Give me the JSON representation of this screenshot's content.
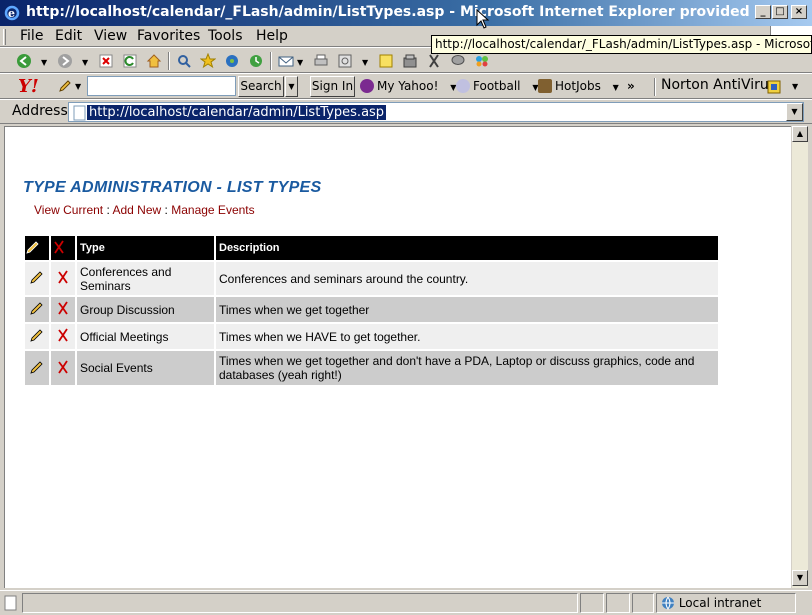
{
  "window": {
    "title": "http://localhost/calendar/_FLash/admin/ListTypes.asp - Microsoft Internet Explorer provided by AT&...",
    "buttons": {
      "minimize": "_",
      "maximize": "□",
      "close": "×"
    }
  },
  "menu": {
    "items": [
      "File",
      "Edit",
      "View",
      "Favorites",
      "Tools",
      "Help"
    ]
  },
  "tooltip": {
    "text": "http://localhost/calendar/_FLash/admin/ListTypes.asp - Microsoft Internet Explorer provided by AT&T"
  },
  "yahoo": {
    "logo": "Y!",
    "search_label": "Search",
    "signin_label": "Sign In",
    "links": [
      "My Yahoo!",
      "Football",
      "HotJobs"
    ],
    "more": "»",
    "antivirus": "Norton AntiVirus"
  },
  "address": {
    "label": "Address",
    "url": "http://localhost/calendar/admin/ListTypes.asp"
  },
  "page": {
    "title": "TYPE ADMINISTRATION - LIST TYPES",
    "nav": {
      "view_current": "View Current",
      "add_new": "Add New",
      "manage_events": "Manage Events",
      "sep": ":"
    },
    "table": {
      "headers": {
        "type": "Type",
        "description": "Description"
      },
      "rows": [
        {
          "type": "Conferences and Seminars",
          "description": "Conferences and seminars around the country."
        },
        {
          "type": "Group Discussion",
          "description": "Times when we get together"
        },
        {
          "type": "Official Meetings",
          "description": "Times when we HAVE to get together."
        },
        {
          "type": "Social Events",
          "description": "Times when we get together and don't have a PDA, Laptop or discuss graphics, code and databases (yeah right!)"
        }
      ]
    }
  },
  "status": {
    "zone": "Local intranet"
  },
  "colors": {
    "title_blue": "#1a5aa0",
    "link": "#8b0000",
    "header_bg": "#000000",
    "row_light": "#efefef",
    "row_dark": "#cccccc",
    "delete_red": "#cc0000"
  }
}
